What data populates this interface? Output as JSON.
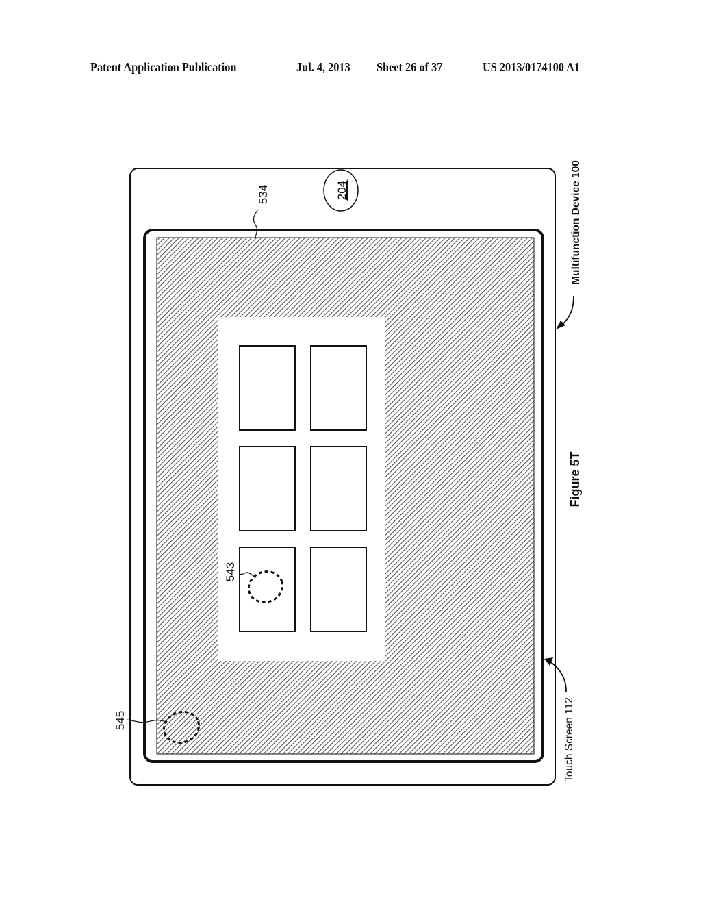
{
  "header": {
    "publication": "Patent Application Publication",
    "date": "Jul. 4, 2013",
    "sheet": "Sheet 26 of 37",
    "number": "US 2013/0174100 A1"
  },
  "figure": {
    "caption": "Figure 5T",
    "device_label": "Multifunction Device 100",
    "touch_screen_label": "Touch Screen 112",
    "home_button_ref": "204",
    "screen_ref": "534",
    "contact_543_ref": "543",
    "contact_545_ref": "545",
    "tiles": [
      {
        "row": 1,
        "col": 1
      },
      {
        "row": 1,
        "col": 2
      },
      {
        "row": 2,
        "col": 1
      },
      {
        "row": 2,
        "col": 2
      },
      {
        "row": 3,
        "col": 1
      },
      {
        "row": 3,
        "col": 2
      }
    ]
  },
  "colors": {
    "ink": "#111111",
    "hatch": "#555555",
    "paper": "#ffffff"
  }
}
